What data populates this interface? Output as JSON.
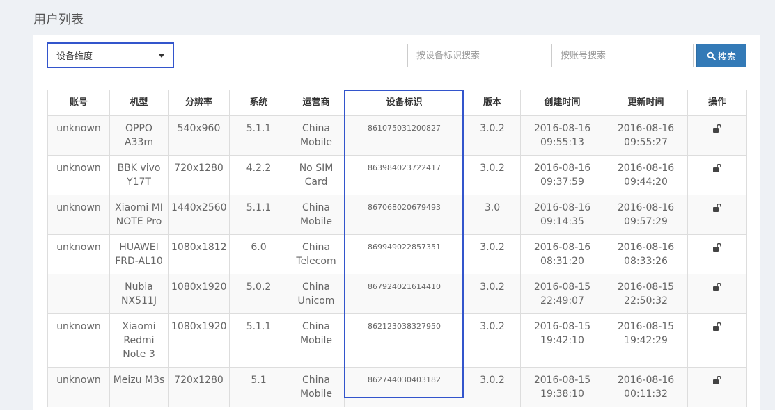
{
  "page": {
    "title": "用户列表"
  },
  "filter": {
    "dimension_label": "设备维度"
  },
  "search": {
    "device_placeholder": "按设备标识搜索",
    "account_placeholder": "按账号搜索",
    "button_label": "搜索"
  },
  "table": {
    "headers": [
      "账号",
      "机型",
      "分辨率",
      "系统",
      "运营商",
      "设备标识",
      "版本",
      "创建时间",
      "更新时间",
      "操作"
    ],
    "rows": [
      {
        "account": "unknown",
        "model": "OPPO A33m",
        "resolution": "540x960",
        "os": "5.1.1",
        "carrier": "China Mobile",
        "device_id": "861075031200827",
        "version": "3.0.2",
        "created": "2016-08-16 09:55:13",
        "updated": "2016-08-16 09:55:27"
      },
      {
        "account": "unknown",
        "model": "BBK vivo Y17T",
        "resolution": "720x1280",
        "os": "4.2.2",
        "carrier": "No SIM Card",
        "device_id": "863984023722417",
        "version": "3.0.2",
        "created": "2016-08-16 09:37:59",
        "updated": "2016-08-16 09:44:20"
      },
      {
        "account": "unknown",
        "model": "Xiaomi MI NOTE Pro",
        "resolution": "1440x2560",
        "os": "5.1.1",
        "carrier": "China Mobile",
        "device_id": "867068020679493",
        "version": "3.0",
        "created": "2016-08-16 09:14:35",
        "updated": "2016-08-16 09:57:29"
      },
      {
        "account": "unknown",
        "model": "HUAWEI FRD-AL10",
        "resolution": "1080x1812",
        "os": "6.0",
        "carrier": "China Telecom",
        "device_id": "869949022857351",
        "version": "3.0.2",
        "created": "2016-08-16 08:31:20",
        "updated": "2016-08-16 08:33:26"
      },
      {
        "account": "",
        "model": "Nubia NX511J",
        "resolution": "1080x1920",
        "os": "5.0.2",
        "carrier": "China Unicom",
        "device_id": "867924021614410",
        "version": "3.0.2",
        "created": "2016-08-15 22:49:07",
        "updated": "2016-08-15 22:50:32"
      },
      {
        "account": "unknown",
        "model": "Xiaomi Redmi Note 3",
        "resolution": "1080x1920",
        "os": "5.1.1",
        "carrier": "China Mobile",
        "device_id": "862123038327950",
        "version": "3.0.2",
        "created": "2016-08-15 19:42:10",
        "updated": "2016-08-15 19:42:29"
      },
      {
        "account": "unknown",
        "model": "Meizu M3s",
        "resolution": "720x1280",
        "os": "5.1",
        "carrier": "China Mobile",
        "device_id": "862744030403182",
        "version": "3.0.2",
        "created": "2016-08-15 19:38:10",
        "updated": "2016-08-16 00:11:32"
      }
    ]
  },
  "colors": {
    "primary": "#337ab7",
    "highlight": "#3355cc",
    "background": "#eef1f5"
  },
  "icons": {
    "search_button": "search-icon",
    "row_action": "unlock-icon"
  }
}
